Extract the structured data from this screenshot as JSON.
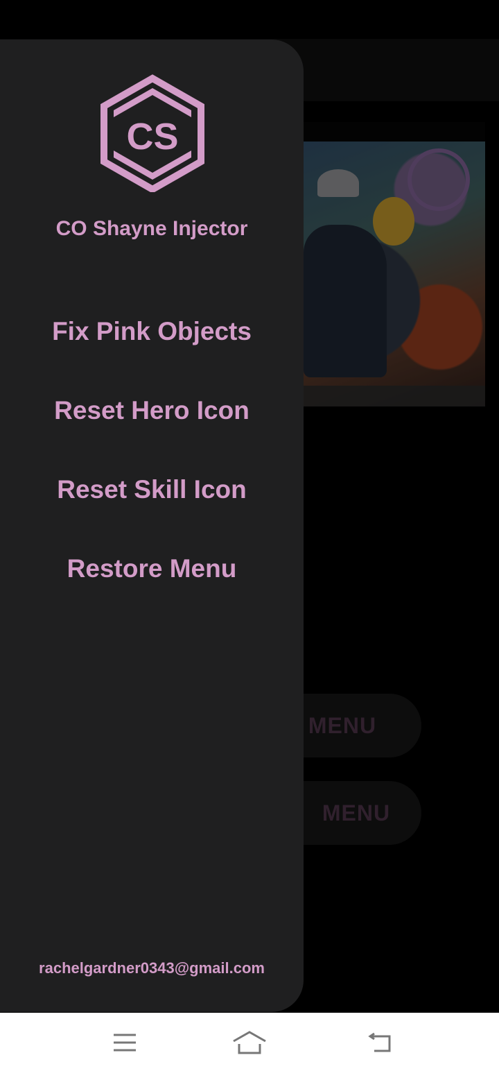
{
  "drawer": {
    "app_name": "CO Shayne Injector",
    "logo_text": "CS",
    "items": [
      {
        "label": "Fix Pink Objects"
      },
      {
        "label": "Reset Hero Icon"
      },
      {
        "label": "Reset Skill Icon"
      },
      {
        "label": "Restore Menu"
      }
    ],
    "email": "rachelgardner0343@gmail.com"
  },
  "background_app": {
    "buttons": [
      {
        "label": "MENU"
      },
      {
        "label": "MENU"
      }
    ]
  },
  "nav_bar": {
    "icons": [
      "menu-icon",
      "home-icon",
      "back-icon"
    ]
  },
  "colors": {
    "accent": "#d39cc8",
    "drawer_bg": "#1f1f20",
    "nav_bg": "#ffffff"
  }
}
